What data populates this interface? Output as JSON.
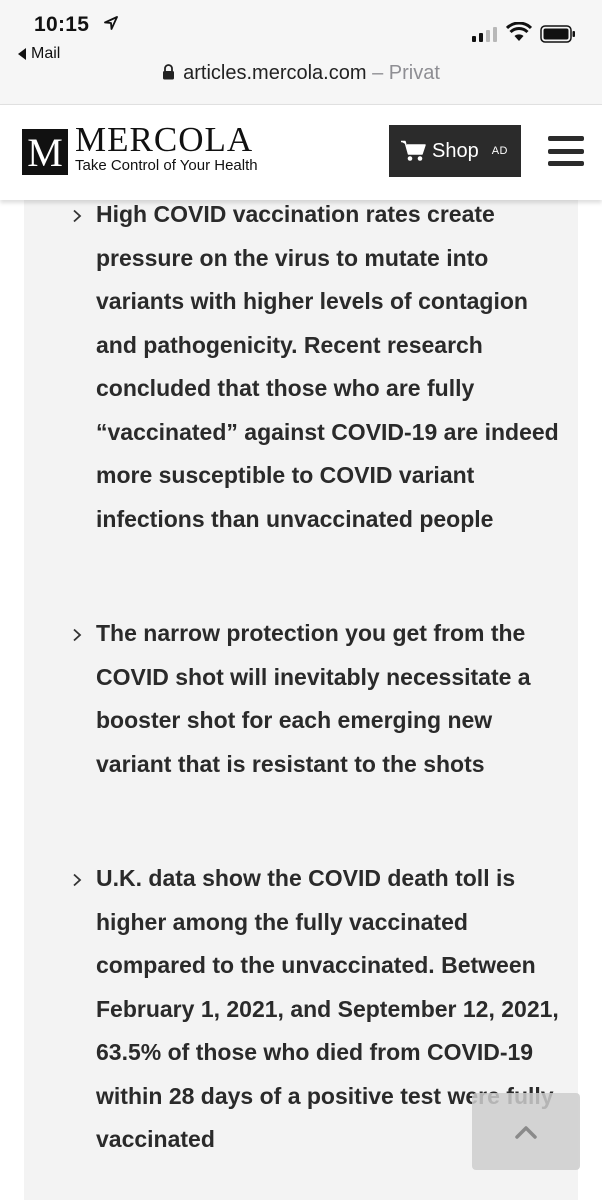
{
  "status_bar": {
    "time": "10:15",
    "back_label": "Mail",
    "url_domain": "articles.mercola.com",
    "url_suffix": " – Privat"
  },
  "header": {
    "logo_letter": "M",
    "logo_name": "MERCOLA",
    "tagline": "Take Control of Your Health",
    "shop_label": "Shop",
    "shop_ad": "AD"
  },
  "bullets": [
    {
      "text": "High COVID vaccination rates create pressure on the virus to mutate into variants with higher levels of contagion and pathogenicity. Recent research concluded that those who are fully “vaccinated” against COVID-19 are indeed more susceptible to COVID variant infections than unvaccinated people"
    },
    {
      "text": "The narrow protection you get from the COVID shot will inevitably necessitate a booster shot for each emerging new variant that is resistant to the shots"
    },
    {
      "text": "U.K. data show the COVID death toll is higher among the fully vaccinated compared to the unvaccinated. Between February 1, 2021, and September 12, 2021, 63.5% of those who died from COVID-19 within 28 days of a positive test were fully vaccinated"
    }
  ]
}
